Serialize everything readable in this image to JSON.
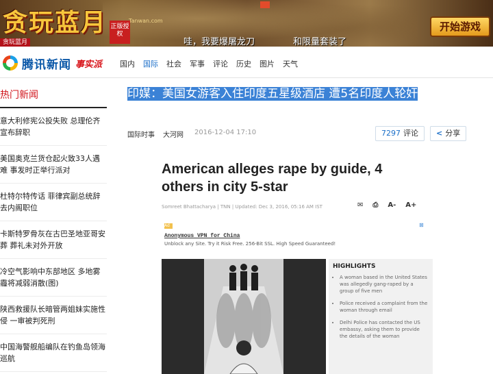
{
  "banner": {
    "game_title": "贪玩蓝月",
    "badge": "正版授权",
    "site": "Tanwan.com",
    "corner_tag": "贪玩蓝月",
    "slogan_left": "哇，我要爆屠龙刀",
    "slogan_right": "和限量套装了",
    "start_button": "开始游戏"
  },
  "nav": {
    "brand_name": "腾讯新闻",
    "brand_sub": "事实派",
    "menu": [
      "国内",
      "国际",
      "社会",
      "军事",
      "评论",
      "历史",
      "图片",
      "天气"
    ],
    "active_index": 1
  },
  "sidebar": {
    "heading": "热门新闻",
    "items": [
      "意大利修宪公投失败 总理伦齐宣布辞职",
      "美国奥克兰货仓起火致33人遇难 事发时正举行派对",
      "杜特尔特传话 菲律宾副总统辞去内阁职位",
      "卡斯特罗骨灰在古巴圣地亚哥安葬 葬礼未对外开放",
      "冷空气影响中东部地区 多地雾霾将减弱消散(图)",
      "陕西救援队长暗管两姐妹实施性侵 一审被判死刑",
      "中国海警舰船编队在钓鱼岛领海巡航"
    ]
  },
  "article": {
    "headline": "印媒：美国女游客入住印度五星级酒店 遭5名印度人轮奸",
    "category": "国际时事",
    "source": "大河网",
    "date": "2016-12-04 17:10",
    "comment_count": "7297",
    "comment_label": "评论",
    "share_label": "分享",
    "embed": {
      "title": "American alleges rape by guide, 4 others in city 5-star",
      "byline": "Somreet Bhattacharya | TNN | Updated: Dec 3, 2016, 05:16 AM IST",
      "tools": [
        "✉",
        "⎙",
        "A-",
        "A+"
      ],
      "ad_tag": "Ad",
      "ad_title": "Anonymous VPN for China",
      "ad_desc": "Unblock any Site. Try it Risk Free. 256-Bit SSL. High Speed Guaranteed!",
      "highlights_heading": "HIGHLIGHTS",
      "highlights": [
        "A woman based in the United States was allegedly gang-raped by a group of five men",
        "Police received a complaint from the woman through email",
        "Delhi Police has contacted the US embassy, asking them to provide the details of the woman"
      ]
    }
  }
}
